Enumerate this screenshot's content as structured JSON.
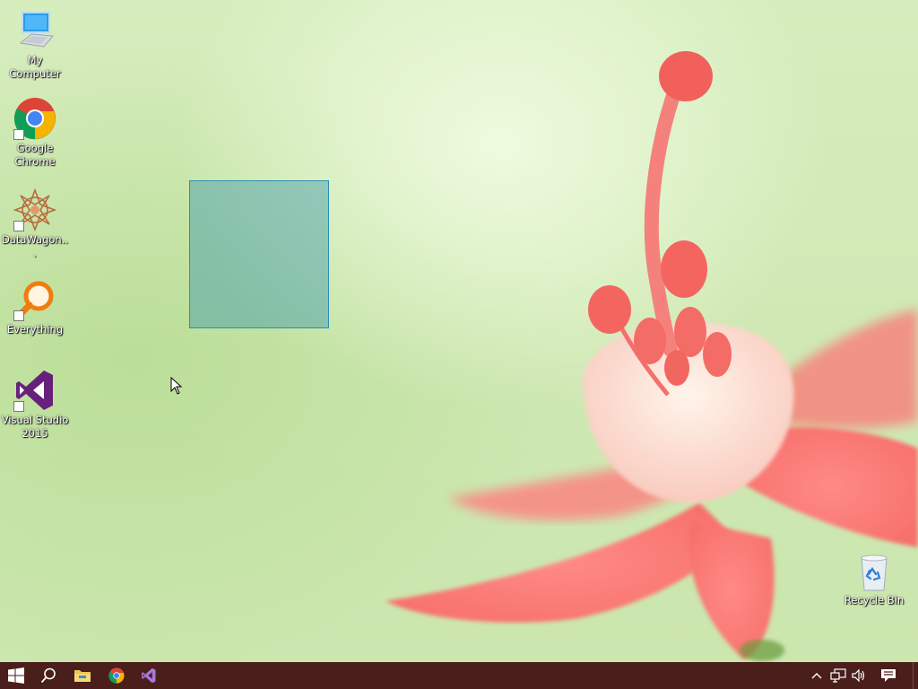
{
  "desktop": {
    "icons": [
      {
        "label": "My Computer",
        "icon": "computer-icon"
      },
      {
        "label": "Google Chrome",
        "icon": "chrome-icon"
      },
      {
        "label": "DataWagon...",
        "icon": "datawagon-icon"
      },
      {
        "label": "Everything",
        "icon": "everything-search-icon"
      },
      {
        "label": "Visual Studio 2015",
        "icon": "visual-studio-icon"
      },
      {
        "label": "Recycle Bin",
        "icon": "recycle-bin-icon"
      }
    ]
  },
  "taskbar": {
    "color": "#4a1e1a",
    "buttons": [
      {
        "icon": "windows-start-icon"
      },
      {
        "icon": "search-icon"
      },
      {
        "icon": "file-explorer-icon"
      },
      {
        "icon": "chrome-icon"
      },
      {
        "icon": "visual-studio-icon"
      }
    ],
    "tray": [
      {
        "icon": "chevron-up-icon"
      },
      {
        "icon": "network-icon"
      },
      {
        "icon": "volume-icon"
      },
      {
        "icon": "action-center-icon"
      }
    ]
  }
}
